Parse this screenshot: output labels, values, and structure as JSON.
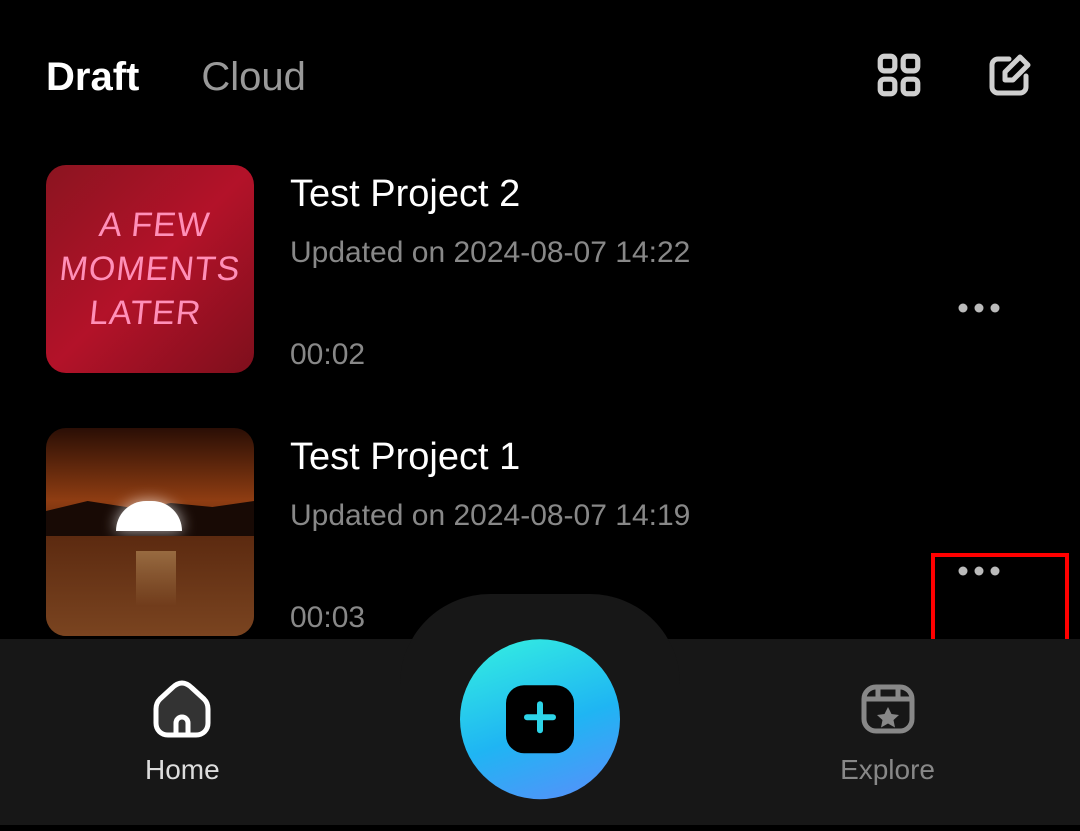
{
  "header": {
    "tabs": {
      "draft": "Draft",
      "cloud": "Cloud"
    }
  },
  "projects": [
    {
      "title": "Test Project 2",
      "updated": "Updated on 2024-08-07 14:22",
      "duration": "00:02",
      "thumb_text": "A FEW\nMOMENTS LATER"
    },
    {
      "title": "Test Project 1",
      "updated": "Updated on 2024-08-07 14:19",
      "duration": "00:03"
    }
  ],
  "nav": {
    "home": "Home",
    "explore": "Explore"
  }
}
